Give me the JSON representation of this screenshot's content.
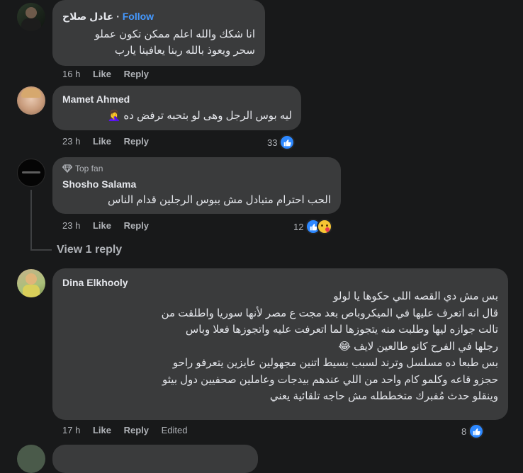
{
  "comments": [
    {
      "name": "عادل صلاح",
      "follow": "Follow",
      "text": "انا شكك والله اعلم ممكن تكون عملو\nسحر ويعوذ بالله ربنا يعافينا يارب",
      "time": "16 h",
      "like": "Like",
      "reply": "Reply"
    },
    {
      "name": "Mamet Ahmed",
      "text": "ليه بوس الرجل وهى لو بتحبه ترفض ده 🤦‍♀️",
      "time": "23 h",
      "like": "Like",
      "reply": "Reply",
      "reactions": "33"
    },
    {
      "badge": "Top fan",
      "name": "Shosho Salama",
      "text": "الحب احترام متبادل مش ببوس الرجلين قدام الناس",
      "time": "23 h",
      "like": "Like",
      "reply": "Reply",
      "reactions": "12"
    },
    {
      "name": "Dina Elkhooly",
      "text": "بس مش دي القصه اللي حكوها يا لولو\nقال انه اتعرف عليها في الميكروباص بعد مجت ع مصر لأنها سوريا واطلقت من\nتالت جوازه ليها وطلبت منه يتجوزها لما اتعرفت عليه واتجوزها فعلا وباس\nرجلها في الفرح كانو طالعين لايف 😂\nبس طبعا ده مسلسل وترند لسبب بسيط اتنين مجهولين عايزين يتعرفو راحو\nحجزو قاعه وكلمو كام واحد من اللي عندهم بيدجات وعاملين صحفيين دول بيثو\nوينقلو حدث مُفبرك متخططله مش حاجه تلقائية يعني",
      "time": "17 h",
      "like": "Like",
      "reply": "Reply",
      "edited": "Edited",
      "reactions": "8"
    }
  ],
  "view_replies": "View 1 reply"
}
